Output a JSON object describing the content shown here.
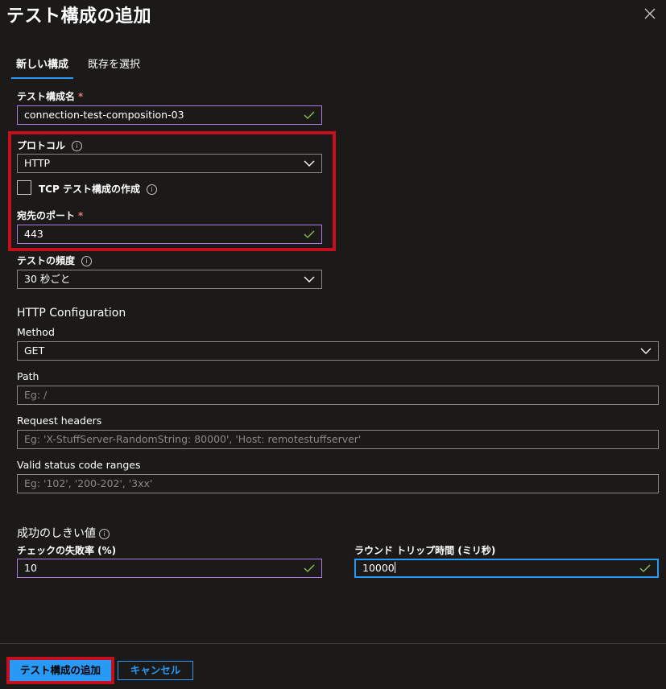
{
  "header": {
    "title": "テスト構成の追加",
    "close_icon": "close-icon"
  },
  "tabs": [
    {
      "label": "新しい構成",
      "active": true
    },
    {
      "label": "既存を選択",
      "active": false
    }
  ],
  "form": {
    "name_label": "テスト構成名",
    "name_value": "connection-test-composition-03",
    "protocol_label": "プロトコル",
    "protocol_value": "HTTP",
    "tcp_checkbox_label": "TCP テスト構成の作成",
    "tcp_checked": false,
    "port_label": "宛先のポート",
    "port_value": "443",
    "frequency_label": "テストの頻度",
    "frequency_value": "30 秒ごと",
    "required_mark": "*"
  },
  "http_config": {
    "heading": "HTTP Configuration",
    "method_label": "Method",
    "method_value": "GET",
    "path_label": "Path",
    "path_placeholder": "Eg: /",
    "headers_label": "Request headers",
    "headers_placeholder": "Eg: 'X-StuffServer-RandomString: 80000', 'Host: remotestuffserver'",
    "status_label": "Valid status code ranges",
    "status_placeholder": "Eg: '102', '200-202', '3xx'"
  },
  "threshold": {
    "heading": "成功のしきい値",
    "failed_checks_label": "チェックの失敗率 (%)",
    "failed_checks_value": "10",
    "rtt_label": "ラウンド トリップ時間 (ミリ秒)",
    "rtt_value": "10000"
  },
  "footer": {
    "add_button": "テスト構成の追加",
    "cancel_button": "キャンセル"
  },
  "colors": {
    "background": "#1b1a19",
    "accent": "#2899f5",
    "highlight": "#c50f1f",
    "valid_border": "#b178e8",
    "check": "#92c353"
  }
}
